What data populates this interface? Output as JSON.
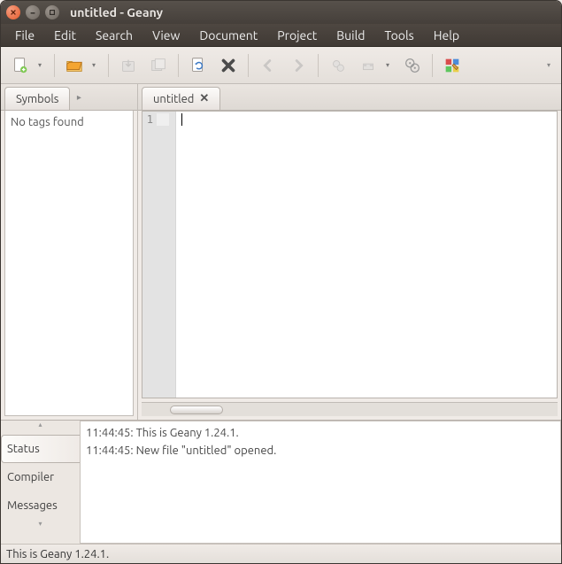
{
  "window": {
    "title": "untitled - Geany"
  },
  "menu": {
    "file": "File",
    "edit": "Edit",
    "search": "Search",
    "view": "View",
    "document": "Document",
    "project": "Project",
    "build": "Build",
    "tools": "Tools",
    "help": "Help"
  },
  "toolbar_icons": {
    "new": "new-file-icon",
    "open": "open-file-icon",
    "save": "save-file-icon",
    "saveall": "save-all-icon",
    "reload": "reload-icon",
    "close": "close-doc-icon",
    "back": "nav-back-icon",
    "forward": "nav-forward-icon",
    "compile": "compile-icon",
    "build": "build-icon",
    "run": "run-icon",
    "colorpick": "color-picker-icon"
  },
  "sidebar": {
    "tab_label": "Symbols",
    "body_text": "No tags found"
  },
  "editor": {
    "tab_label": "untitled",
    "line_numbers": [
      "1"
    ],
    "content": ""
  },
  "bottom_panel": {
    "tabs": {
      "status": "Status",
      "compiler": "Compiler",
      "messages": "Messages"
    },
    "lines": [
      "11:44:45: This is Geany 1.24.1.",
      "11:44:45: New file \"untitled\" opened."
    ]
  },
  "statusbar": {
    "text": "This is Geany 1.24.1."
  }
}
